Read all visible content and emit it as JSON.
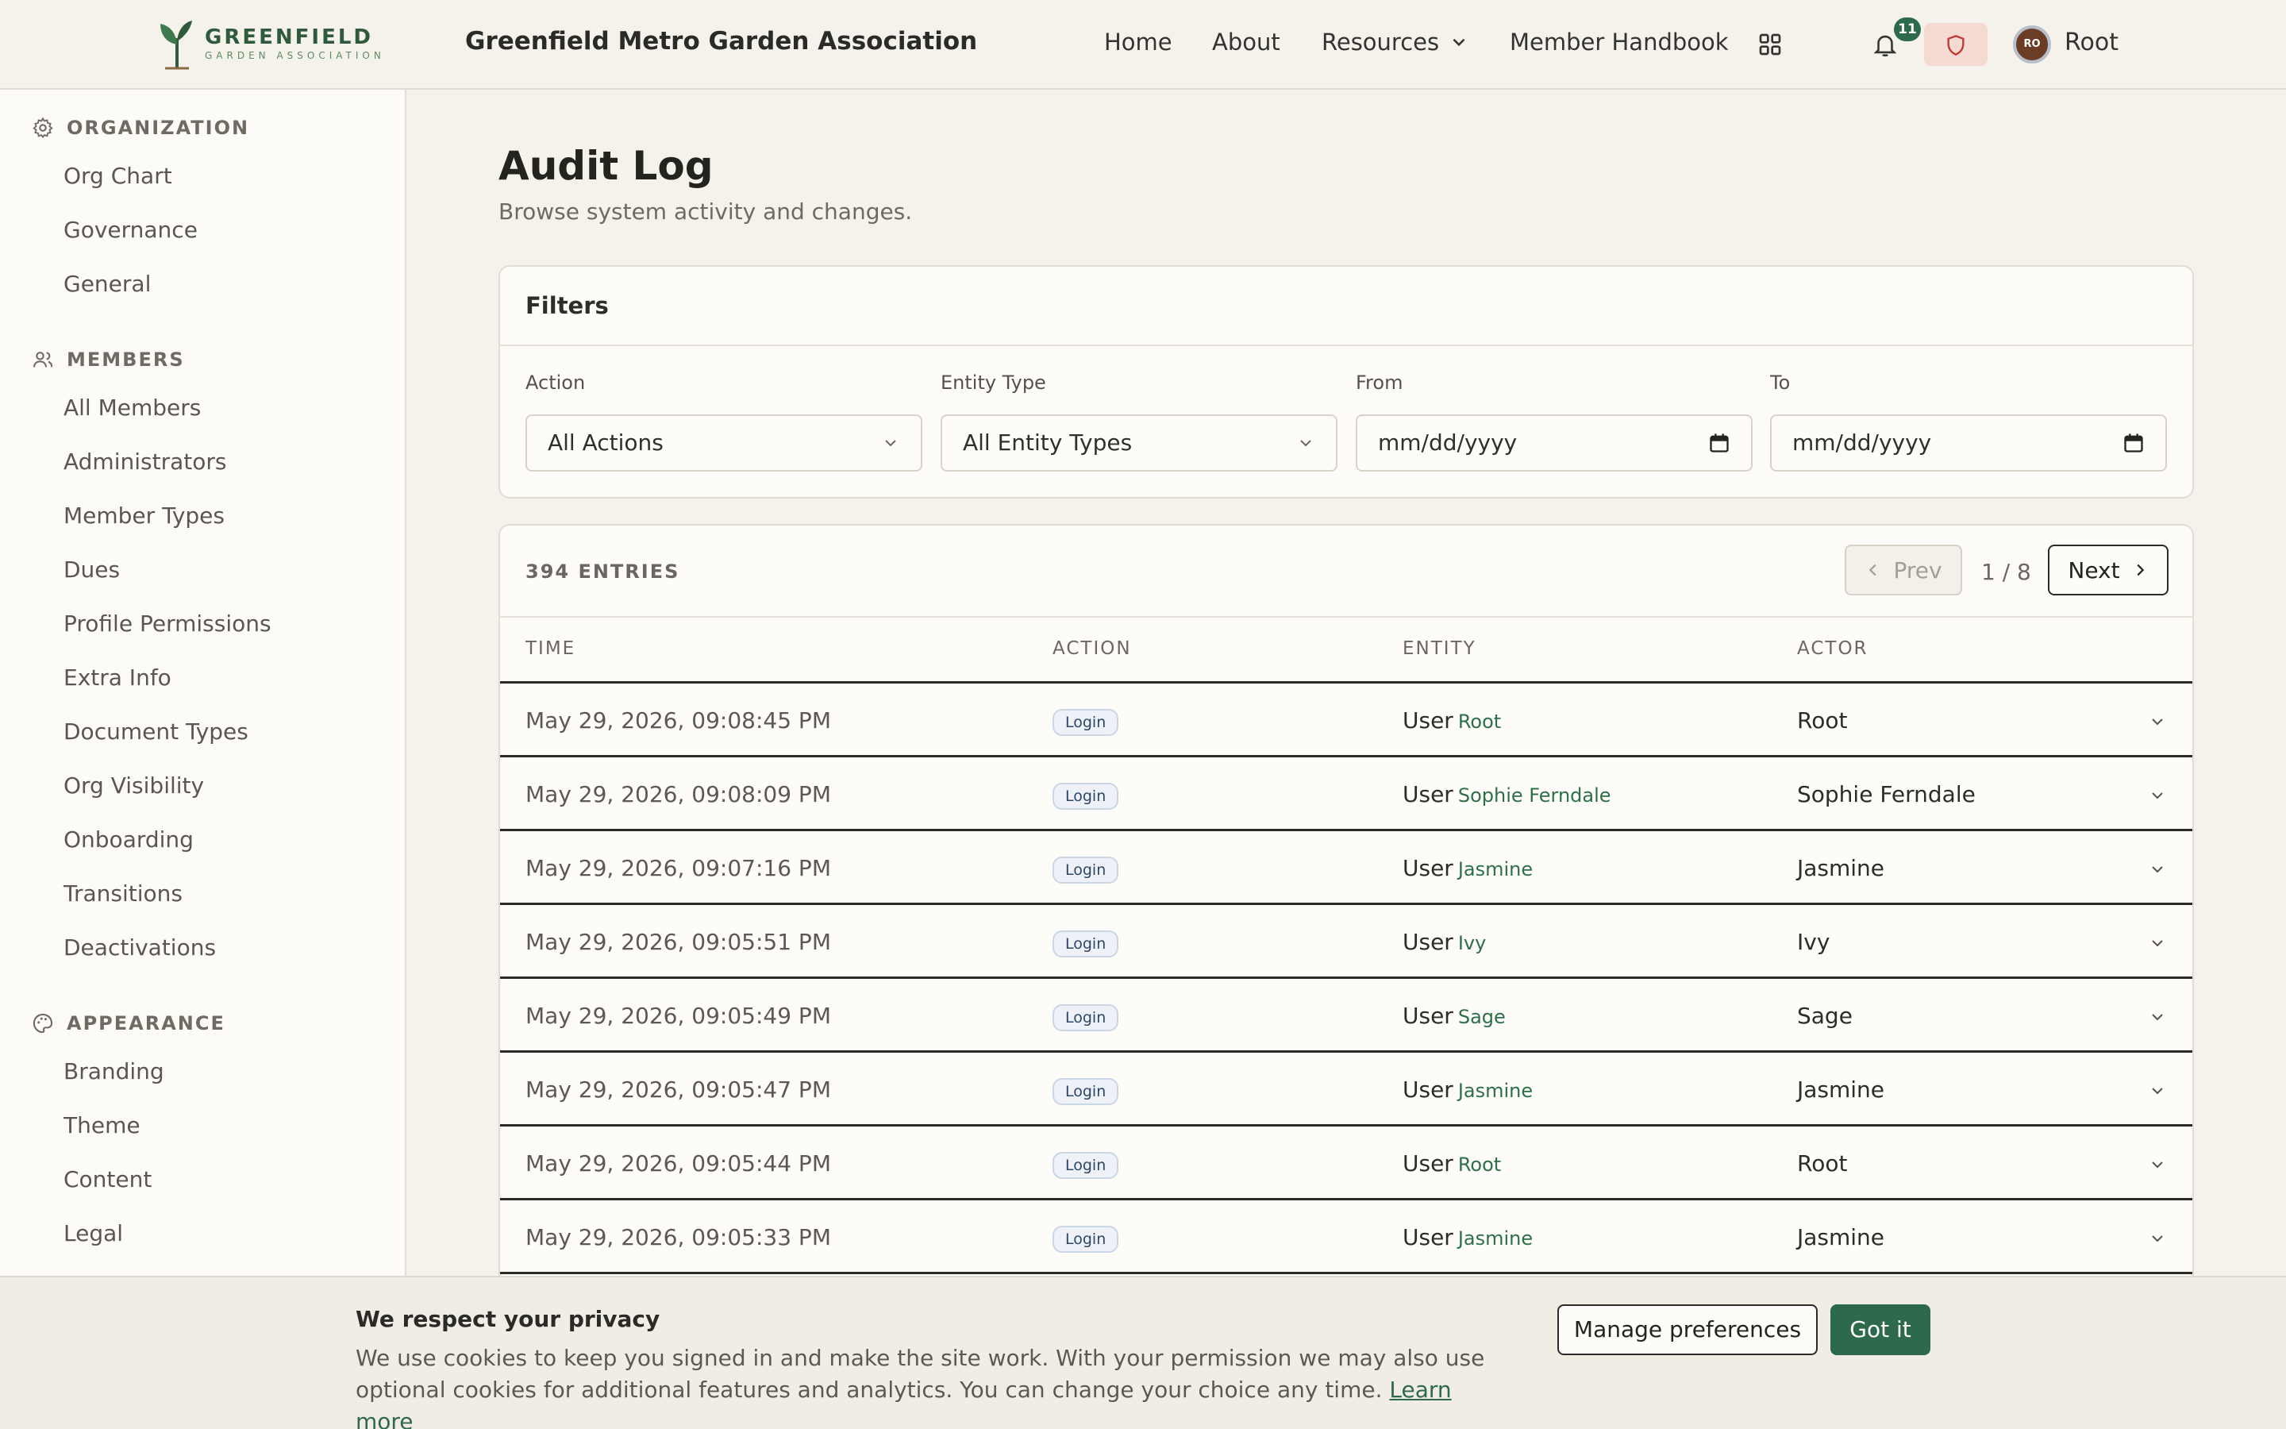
{
  "header": {
    "logo_main": "GREENFIELD",
    "logo_sub": "GARDEN ASSOCIATION",
    "org_name": "Greenfield Metro Garden Association",
    "nav": {
      "home": "Home",
      "about": "About",
      "resources": "Resources",
      "handbook": "Member Handbook"
    },
    "notifications_count": "11",
    "user_initials": "RO",
    "user_name": "Root"
  },
  "sidebar": {
    "sections": [
      {
        "heading": "ORGANIZATION",
        "icon": "gear-icon",
        "items": [
          "Org Chart",
          "Governance",
          "General"
        ]
      },
      {
        "heading": "MEMBERS",
        "icon": "users-icon",
        "items": [
          "All Members",
          "Administrators",
          "Member Types",
          "Dues",
          "Profile Permissions",
          "Extra Info",
          "Document Types",
          "Org Visibility",
          "Onboarding",
          "Transitions",
          "Deactivations"
        ]
      },
      {
        "heading": "APPEARANCE",
        "icon": "palette-icon",
        "items": [
          "Branding",
          "Theme",
          "Content",
          "Legal"
        ]
      }
    ]
  },
  "main": {
    "title": "Audit Log",
    "subtitle": "Browse system activity and changes.",
    "filters": {
      "title": "Filters",
      "action_label": "Action",
      "action_value": "All Actions",
      "entity_label": "Entity Type",
      "entity_value": "All Entity Types",
      "from_label": "From",
      "from_placeholder": "mm/dd/yyyy",
      "to_label": "To",
      "to_placeholder": "mm/dd/yyyy"
    },
    "table": {
      "entries": "394 ENTRIES",
      "prev": "Prev",
      "next": "Next",
      "page": "1 / 8",
      "columns": {
        "time": "TIME",
        "action": "ACTION",
        "entity": "ENTITY",
        "actor": "ACTOR"
      },
      "rows": [
        {
          "time": "May 29, 2026, 09:08:45 PM",
          "action": "Login",
          "entity_type": "User",
          "entity_name": "Root",
          "actor": "Root"
        },
        {
          "time": "May 29, 2026, 09:08:09 PM",
          "action": "Login",
          "entity_type": "User",
          "entity_name": "Sophie Ferndale",
          "actor": "Sophie Ferndale"
        },
        {
          "time": "May 29, 2026, 09:07:16 PM",
          "action": "Login",
          "entity_type": "User",
          "entity_name": "Jasmine",
          "actor": "Jasmine"
        },
        {
          "time": "May 29, 2026, 09:05:51 PM",
          "action": "Login",
          "entity_type": "User",
          "entity_name": "Ivy",
          "actor": "Ivy"
        },
        {
          "time": "May 29, 2026, 09:05:49 PM",
          "action": "Login",
          "entity_type": "User",
          "entity_name": "Sage",
          "actor": "Sage"
        },
        {
          "time": "May 29, 2026, 09:05:47 PM",
          "action": "Login",
          "entity_type": "User",
          "entity_name": "Jasmine",
          "actor": "Jasmine"
        },
        {
          "time": "May 29, 2026, 09:05:44 PM",
          "action": "Login",
          "entity_type": "User",
          "entity_name": "Root",
          "actor": "Root"
        },
        {
          "time": "May 29, 2026, 09:05:33 PM",
          "action": "Login",
          "entity_type": "User",
          "entity_name": "Jasmine",
          "actor": "Jasmine"
        }
      ]
    }
  },
  "cookie": {
    "title": "We respect your privacy",
    "text": "We use cookies to keep you signed in and make the site work. With your permission we may also use optional cookies for additional features and analytics. You can change your choice any time.",
    "learn_more": "Learn more",
    "manage": "Manage preferences",
    "accept": "Got it"
  },
  "colors": {
    "brand_green": "#2d6a4b",
    "background": "#f5f2ec",
    "alert_bg": "#f5d9d3",
    "badge_bg": "#eef2f8"
  }
}
